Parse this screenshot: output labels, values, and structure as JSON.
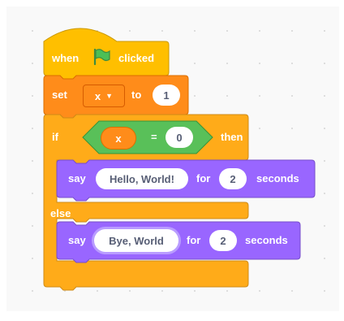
{
  "hat": {
    "when": "when",
    "clicked": "clicked"
  },
  "set": {
    "label": "set",
    "var": "x",
    "to": "to",
    "value": "1"
  },
  "if_block": {
    "if": "if",
    "condition": {
      "left": "x",
      "op": "=",
      "right": "0"
    },
    "then": "then",
    "else": "else"
  },
  "say1": {
    "say": "say",
    "message": "Hello, World!",
    "for": "for",
    "secs": "2",
    "seconds": "seconds"
  },
  "say2": {
    "say": "say",
    "message": "Bye, World",
    "for": "for",
    "secs": "2",
    "seconds": "seconds"
  },
  "colors": {
    "events": "#ffbf00",
    "variables": "#ff8c1a",
    "control": "#ffab19",
    "operators": "#59c059",
    "looks": "#9966ff"
  },
  "icons": [
    "green-flag-icon",
    "dropdown-caret-icon"
  ]
}
